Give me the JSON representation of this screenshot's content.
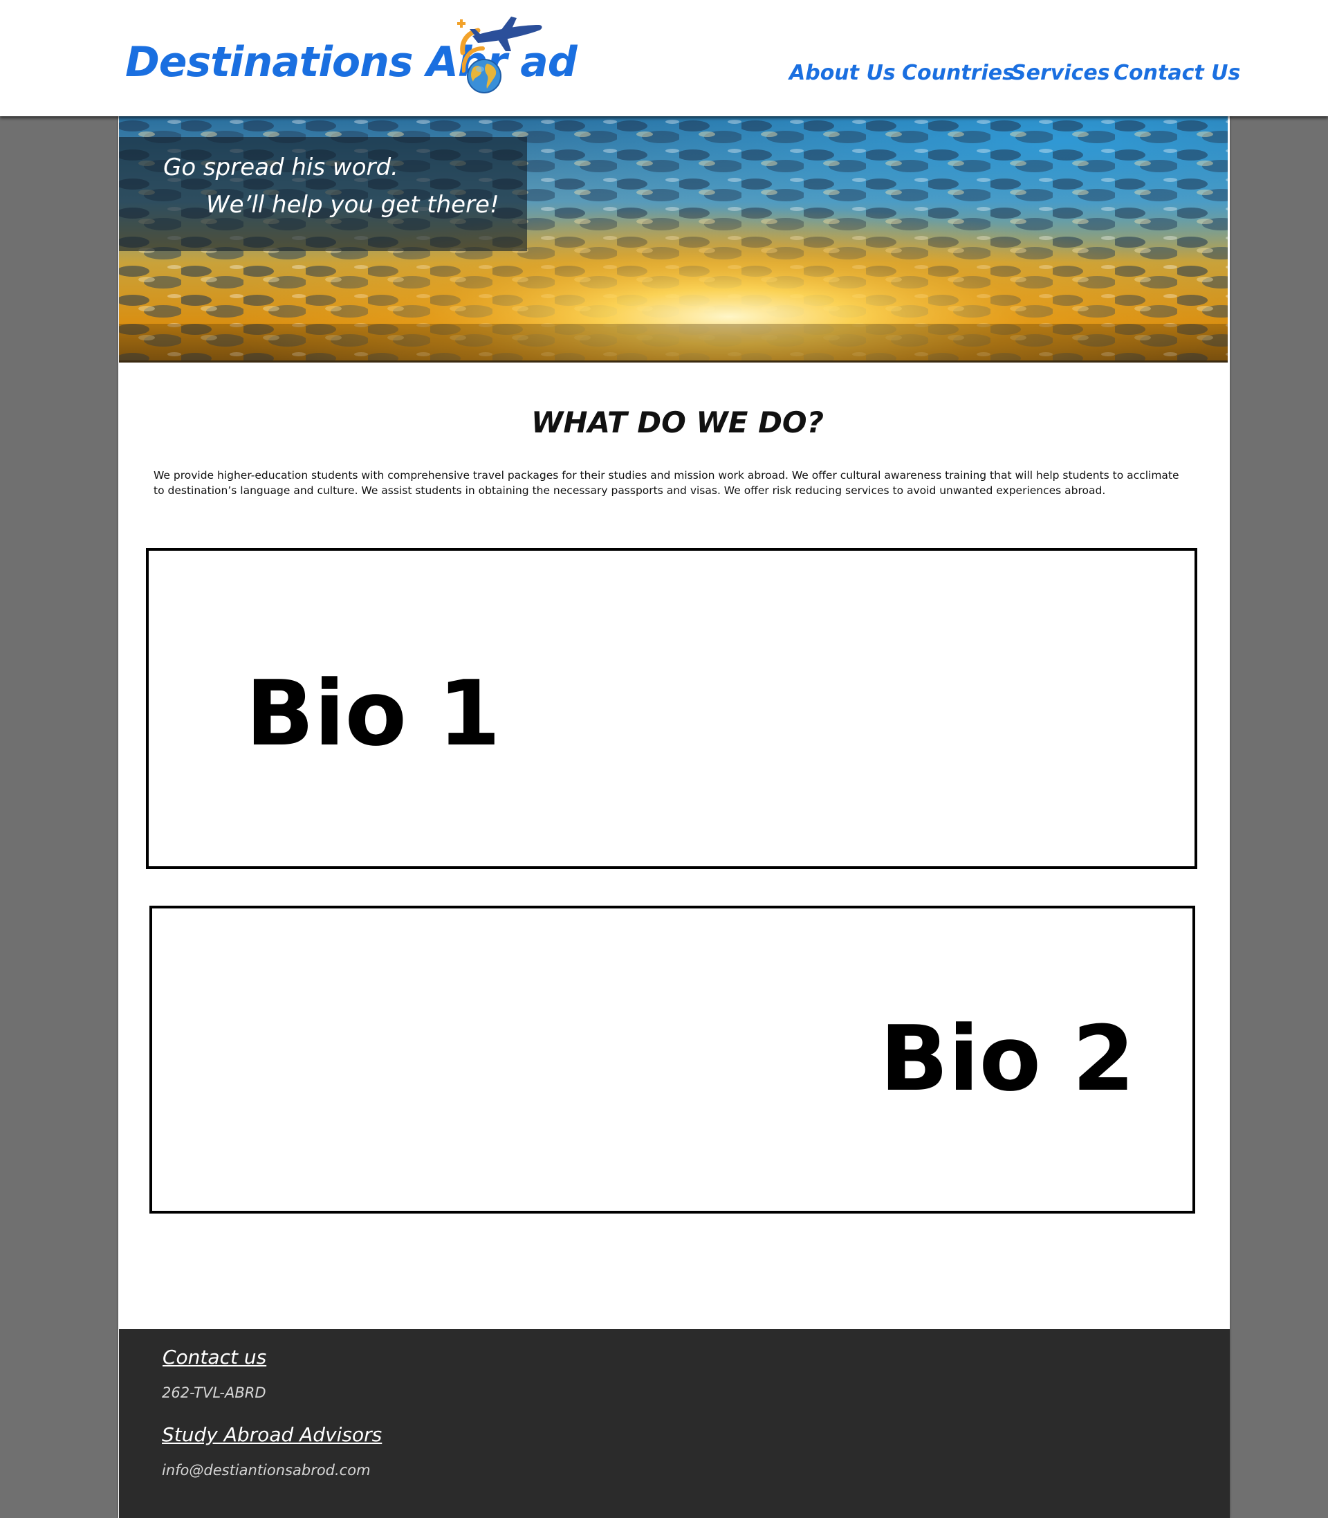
{
  "header": {
    "logo_text": "Destinations Abr    ad",
    "nav": {
      "about": "About Us",
      "countries": "Countries",
      "services": "Services",
      "contact": "Contact Us"
    }
  },
  "hero": {
    "tagline_line1": "Go spread his word.",
    "tagline_line2": "We’ll help you get there!"
  },
  "main": {
    "title": "WHAT DO WE DO?",
    "intro": "We provide higher-education students with comprehensive travel packages for their studies and mission work abroad.  We offer cultural awareness training that will help students to acclimate to destination’s language and culture.  We assist students in obtaining the necessary passports and visas.   We offer risk reducing services to avoid unwanted experiences abroad.",
    "bios": [
      {
        "label": "Bio 1"
      },
      {
        "label": "Bio 2"
      }
    ]
  },
  "footer": {
    "contact_heading": "Contact us",
    "phone": "262-TVL-ABRD",
    "advisors_heading": "Study Abroad Advisors",
    "email": "info@destiantionsabrod.com"
  },
  "colors": {
    "brand_blue": "#1a6fe0",
    "page_bg": "#707070",
    "footer_bg": "#2b2b2b"
  },
  "icons": [
    "airplane-icon",
    "globe-icon"
  ]
}
